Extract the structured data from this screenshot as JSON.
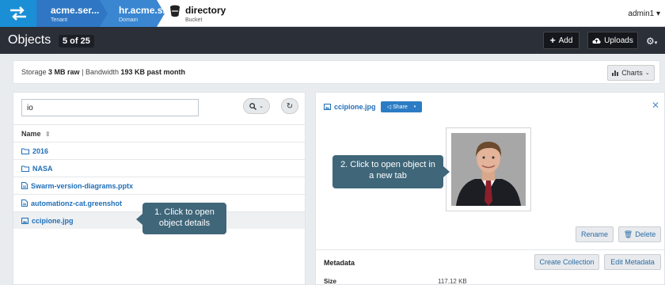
{
  "topbar": {
    "tenant": {
      "name": "acme.ser...",
      "label": "Tenant"
    },
    "domain": {
      "name": "hr.acme.s..",
      "label": "Domain"
    },
    "bucket": {
      "name": "directory",
      "label": "Bucket"
    },
    "user": "admin1 ▾"
  },
  "header": {
    "title": "Objects",
    "count": "5 of 25",
    "add_label": "Add",
    "uploads_label": "Uploads"
  },
  "storage": {
    "storage_label": "Storage",
    "storage_value": "3 MB raw",
    "separator": "|",
    "bandwidth_label": "Bandwidth",
    "bandwidth_value": "193 KB past month",
    "charts_label": "Charts"
  },
  "list": {
    "search_value": "io",
    "column_name": "Name",
    "items": [
      {
        "name": "2016",
        "kind": "folder"
      },
      {
        "name": "NASA",
        "kind": "folder"
      },
      {
        "name": "Swarm-version-diagrams.pptx",
        "kind": "file"
      },
      {
        "name": "automationz-cat.greenshot",
        "kind": "file"
      },
      {
        "name": "ccipione.jpg",
        "kind": "image",
        "selected": true
      }
    ]
  },
  "callouts": {
    "details": "1. Click to open object details",
    "newtab": "2. Click to open object in a new tab"
  },
  "detail": {
    "file_name": "ccipione.jpg",
    "share_label": "Share",
    "rename_label": "Rename",
    "delete_label": "Delete",
    "create_collection_label": "Create Collection",
    "edit_metadata_label": "Edit Metadata",
    "metadata_label": "Metadata",
    "size_label": "Size",
    "size_value": "117.12 KB"
  },
  "colors": {
    "accent": "#1a8fd6",
    "header_dark": "#2a2f38",
    "callout": "#3f6679",
    "link": "#1f6fb8"
  }
}
